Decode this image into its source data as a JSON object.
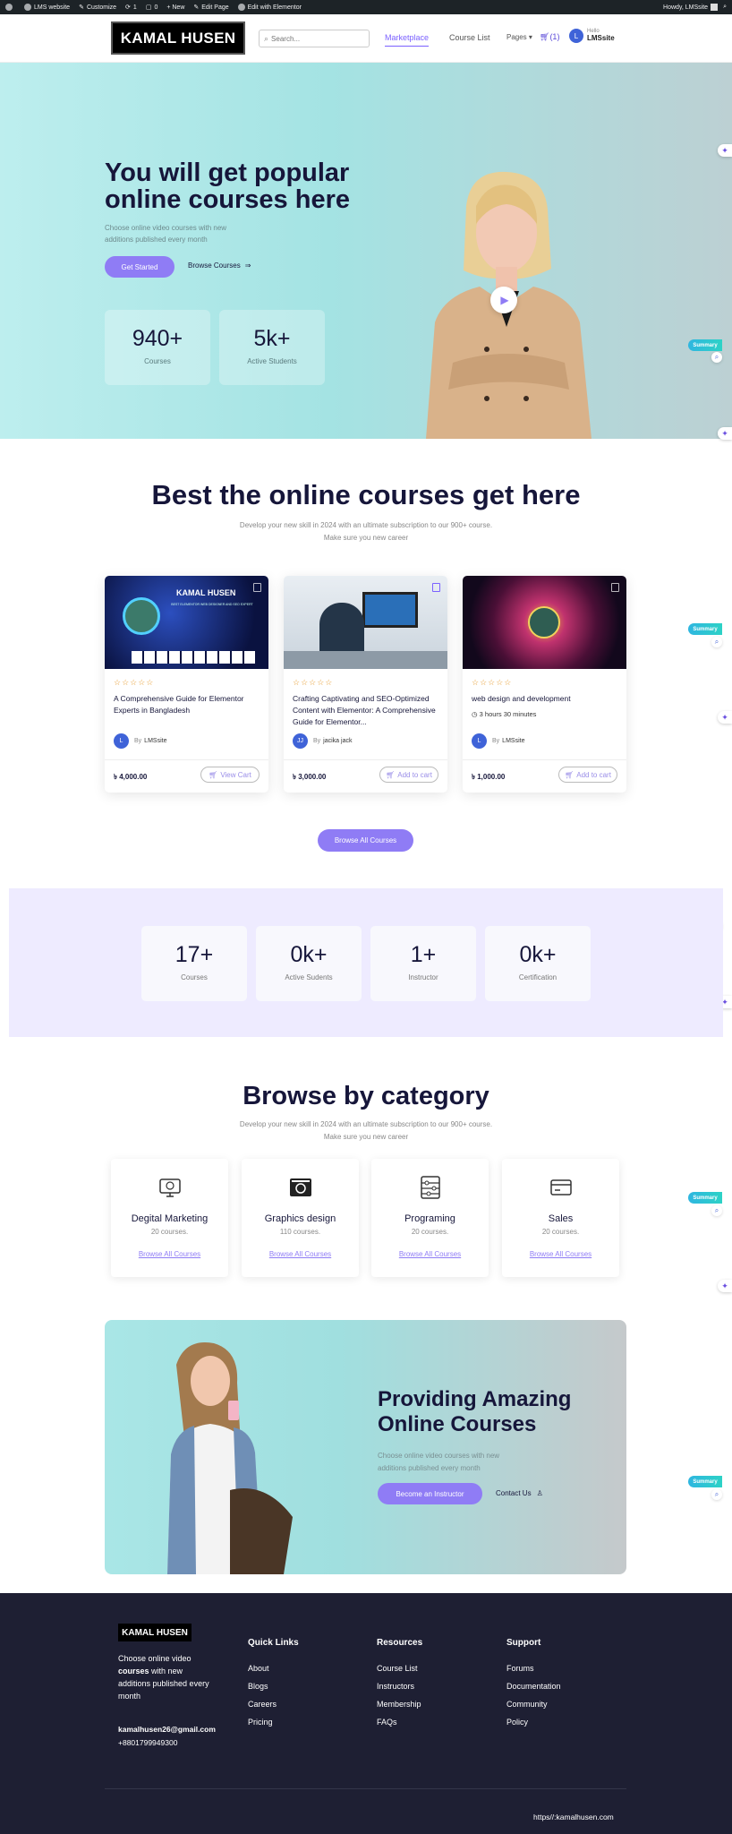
{
  "adminbar": {
    "site": "LMS website",
    "customize": "Customize",
    "updates": "1",
    "comments": "0",
    "new": "+ New",
    "edit_page": "Edit Page",
    "edit_elementor": "Edit with Elementor",
    "howdy": "Howdy, LMSsite"
  },
  "header": {
    "logo": "KAMAL HUSEN",
    "search_placeholder": "Search...",
    "nav": [
      "Marketplace",
      "Course List",
      "Pages"
    ],
    "cart_count": "(1)",
    "avatar_letter": "L",
    "hello": "Hello",
    "username": "LMSsite"
  },
  "hero": {
    "title": "You will get popular online courses here",
    "subtitle": "Choose online video courses with new additions published every month",
    "cta": "Get Started",
    "browse": "Browse Courses",
    "stats": [
      {
        "number": "940+",
        "label": "Courses"
      },
      {
        "number": "5k+",
        "label": "Active Students"
      }
    ]
  },
  "widgets": {
    "summary": "Summary"
  },
  "courses_section": {
    "title": "Best the online courses get here",
    "subtitle_line1": "Develop your new skill in 2024 with an ultimate subscription to our 900+ course.",
    "subtitle_line2": "Make sure you new career",
    "cards": [
      {
        "thumb_title": "KAMAL HUSEN",
        "thumb_tag": "BEST ELEMENTOR WEB DESIGNER AND SEO EXPERT",
        "title": "A Comprehensive Guide for Elementor Experts in Bangladesh",
        "duration": "",
        "author_initial": "L",
        "author_prefix": "By",
        "author": "LMSsite",
        "price": "৳ 4,000.00",
        "button": "View Cart"
      },
      {
        "title": "Crafting Captivating and SEO-Optimized Content with Elementor: A Comprehensive Guide for Elementor...",
        "duration": "",
        "author_initial": "JJ",
        "author_prefix": "By",
        "author": "jacika jack",
        "price": "৳ 3,000.00",
        "button": "Add to cart"
      },
      {
        "title": "web design and development",
        "duration": "3 hours 30 minutes",
        "author_initial": "L",
        "author_prefix": "By",
        "author": "LMSsite",
        "price": "৳ 1,000.00",
        "button": "Add to cart"
      }
    ],
    "browse_all": "Browse All Courses"
  },
  "stats_band": [
    {
      "number": "17+",
      "label": "Courses"
    },
    {
      "number": "0k+",
      "label": "Active Sudents"
    },
    {
      "number": "1+",
      "label": "Instructor"
    },
    {
      "number": "0k+",
      "label": "Certification"
    }
  ],
  "categories": {
    "title": "Browse by category",
    "subtitle_line1": "Develop your new skill in 2024 with an ultimate subscription to our 900+ course.",
    "subtitle_line2": "Make sure you new career",
    "items": [
      {
        "name": "Degital Marketing",
        "count": "20 courses.",
        "link": "Browse All Courses",
        "icon": "marketing-icon"
      },
      {
        "name": "Graphics design",
        "count": "110 courses.",
        "link": "Browse All Courses",
        "icon": "graphics-icon"
      },
      {
        "name": "Programing",
        "count": "20 courses.",
        "link": "Browse All Courses",
        "icon": "programming-icon"
      },
      {
        "name": "Sales",
        "count": "20 courses.",
        "link": "Browse All Courses",
        "icon": "sales-icon"
      }
    ]
  },
  "promo": {
    "title": "Providing Amazing Online Courses",
    "subtitle": "Choose online video courses with new additions published every month",
    "cta": "Become an Instructor",
    "contact": "Contact Us"
  },
  "footer": {
    "logo": "KAMAL HUSEN",
    "desc_pre": "Choose online video ",
    "desc_bold": "courses",
    "desc_post": " with new additions published every month",
    "email": "kamalhusen26@gmail.com",
    "phone": "+8801799949300",
    "columns": [
      {
        "heading": "Quick Links",
        "links": [
          "About",
          "Blogs",
          "Careers",
          "Pricing"
        ]
      },
      {
        "heading": "Resources",
        "links": [
          "Course List",
          "Instructors",
          "Membership",
          "FAQs"
        ]
      },
      {
        "heading": "Support",
        "links": [
          "Forums",
          "Documentation",
          "Community",
          "Policy"
        ]
      }
    ],
    "url": "https//:kamalhusen.com"
  },
  "colors": {
    "accent": "#8f7cf5",
    "hero_bg": "#a4e3e3",
    "footer_bg": "#1e1f33",
    "star": "#e8a13a"
  }
}
